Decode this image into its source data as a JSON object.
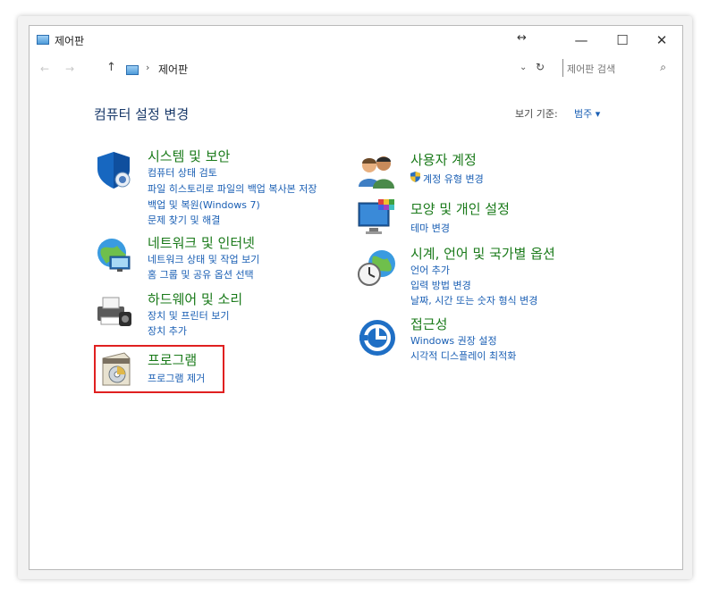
{
  "window": {
    "title": "제어판",
    "resize_glyph": "↔",
    "minimize": "—",
    "maximize": "☐",
    "close": "✕"
  },
  "address": {
    "back": "←",
    "forward": "→",
    "up": "↑",
    "separator": "›",
    "crumb": "제어판",
    "dropdown": "⌄",
    "refresh": "↻",
    "search_placeholder": "제어판 검색",
    "search_glyph": "⌕"
  },
  "page": {
    "title": "컴퓨터 설정 변경",
    "view_by_label": "보기 기준:",
    "view_by_value": "범주 ▾"
  },
  "categories": {
    "system": {
      "title": "시스템 및 보안",
      "links": [
        "컴퓨터 상태 검토",
        "파일 히스토리로 파일의 백업 복사본 저장",
        "백업 및 복원(Windows 7)",
        "문제 찾기 및 해결"
      ]
    },
    "network": {
      "title": "네트워크 및 인터넷",
      "links": [
        "네트워크 상태 및 작업 보기",
        "홈 그룹 및 공유 옵션 선택"
      ]
    },
    "hardware": {
      "title": "하드웨어 및 소리",
      "links": [
        "장치 및 프린터 보기",
        "장치 추가"
      ]
    },
    "programs": {
      "title": "프로그램",
      "links": [
        "프로그램 제거"
      ]
    },
    "users": {
      "title": "사용자 계정",
      "links": [
        "계정 유형 변경"
      ]
    },
    "appearance": {
      "title": "모양 및 개인 설정",
      "links": [
        "테마 변경"
      ]
    },
    "clock": {
      "title": "시계, 언어 및 국가별 옵션",
      "links": [
        "언어 추가",
        "입력 방법 변경",
        "날짜, 시간 또는 숫자 형식 변경"
      ]
    },
    "ease": {
      "title": "접근성",
      "links": [
        "Windows 권장 설정",
        "시각적 디스플레이 최적화"
      ]
    }
  },
  "colors": {
    "category_title": "#1a7a1a",
    "link": "#1a5fb4",
    "highlight_box": "#e02020"
  }
}
